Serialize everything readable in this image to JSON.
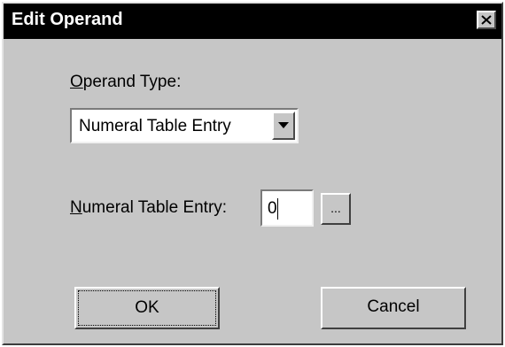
{
  "window": {
    "title": "Edit Operand",
    "close_label": "close"
  },
  "operand_type": {
    "label_underlined": "O",
    "label_rest": "perand Type:",
    "selected": "Numeral Table Entry"
  },
  "numeral_entry": {
    "label_underlined": "N",
    "label_rest": "umeral Table Entry:",
    "value": "0",
    "browse_label": "..."
  },
  "buttons": {
    "ok": "OK",
    "cancel": "Cancel"
  },
  "colors": {
    "dialog_bg": "#c6c6c6",
    "titlebar_bg": "#000000",
    "title_text": "#ffffff"
  }
}
